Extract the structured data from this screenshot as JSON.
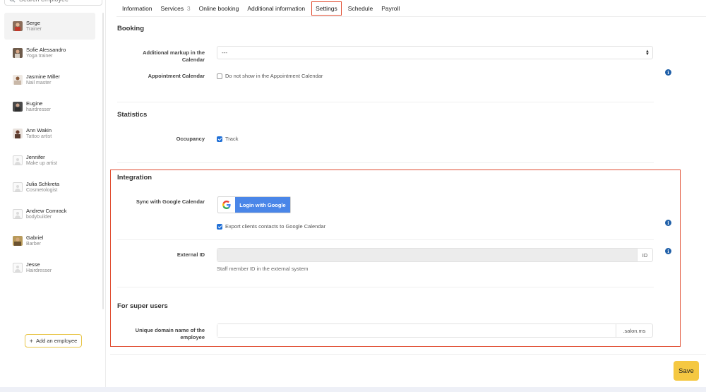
{
  "search": {
    "placeholder": "Search employee"
  },
  "employees": [
    {
      "name": "Serge",
      "role": "Trainer",
      "active": true
    },
    {
      "name": "Sofie Alessandro",
      "role": "Yoga trainer"
    },
    {
      "name": "Jasmine Miller",
      "role": "Nail master"
    },
    {
      "name": "Eugine",
      "role": "hairdresser"
    },
    {
      "name": "Ann Wakin",
      "role": "Tattoo artist"
    },
    {
      "name": "Jennifer",
      "role": "Make up artist"
    },
    {
      "name": "Julia Schkreta",
      "role": "Cosmetologist"
    },
    {
      "name": "Andrew Comrack",
      "role": "bodybuilder"
    },
    {
      "name": "Gabriel",
      "role": "Barber"
    },
    {
      "name": "Jesse",
      "role": "Hairdresser"
    }
  ],
  "sidebar": {
    "add_employee_label": "Add an employee"
  },
  "tabs": {
    "information": "Information",
    "services": "Services",
    "services_count": "3",
    "online_booking": "Online booking",
    "additional_information": "Additional information",
    "settings": "Settings",
    "schedule": "Schedule",
    "payroll": "Payroll",
    "active": "settings"
  },
  "booking": {
    "title": "Booking",
    "markup_label": "Additional markup in the Calendar",
    "markup_value": "---",
    "calendar_label": "Appointment Calendar",
    "calendar_option": "Do not show in the Appointment Calendar"
  },
  "statistics": {
    "title": "Statistics",
    "occupancy_label": "Occupancy",
    "track_option": "Track"
  },
  "integration": {
    "title": "Integration",
    "sync_label": "Sync with Google Calendar",
    "google_button": "Login with Google",
    "export_option": "Export clients contacts to Google Calendar",
    "external_id_label": "External ID",
    "external_id_addon": "ID",
    "external_id_hint": "Staff member ID in the external system"
  },
  "super_users": {
    "title": "For super users",
    "domain_label": "Unique domain name of the employee",
    "domain_addon": ".salon.ms"
  },
  "footer": {
    "save_label": "Save"
  },
  "colors": {
    "accent_yellow": "#f5c842",
    "highlight_red": "#e04b2f",
    "google_blue": "#4a86e8",
    "checkbox_blue": "#1f6fd6",
    "info_blue": "#1f5fa8"
  }
}
